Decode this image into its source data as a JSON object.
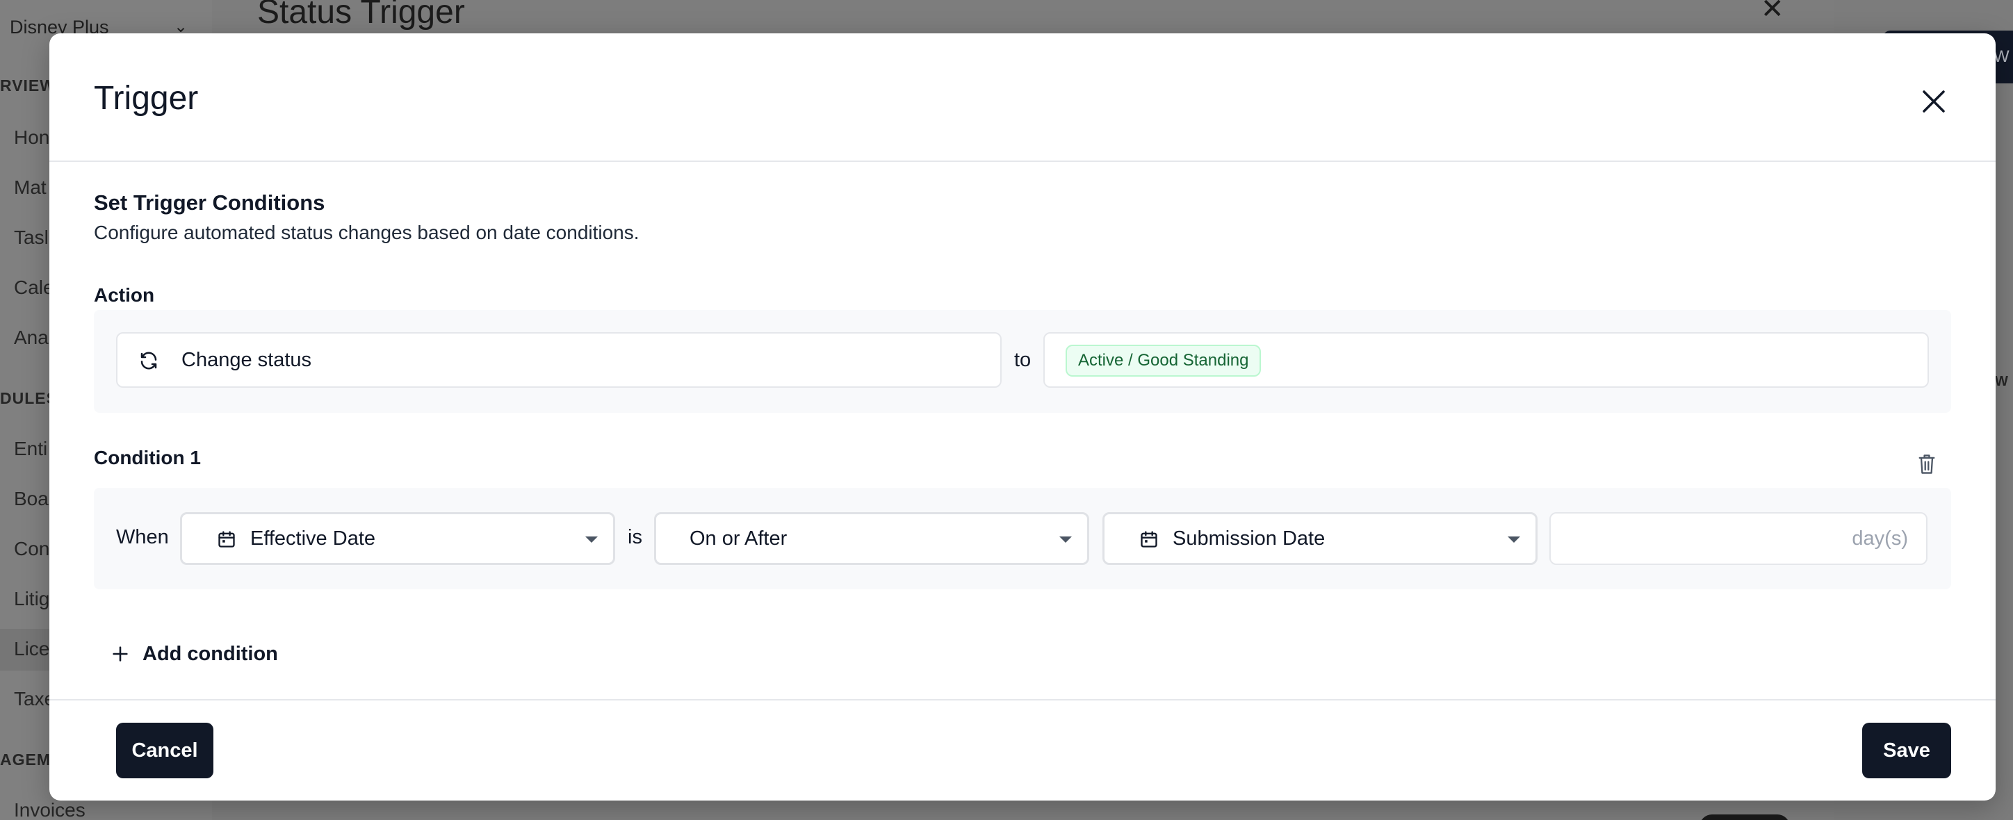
{
  "background": {
    "account": "Disney Plus",
    "sections": [
      "RVIEW",
      "DULES",
      "AGEM"
    ],
    "sidebar_items": [
      "Hon",
      "Mat",
      "Tasl",
      "Cale",
      "Ana",
      "Enti",
      "Boa",
      "Con",
      "Litig",
      "Lice",
      "Taxe",
      "Invoices"
    ],
    "dialog_title": "Status Trigger",
    "side_text": "W"
  },
  "modal": {
    "title": "Trigger",
    "section_title": "Set Trigger Conditions",
    "section_desc": "Configure automated status changes based on date conditions.",
    "action": {
      "label": "Action",
      "action_value": "Change status",
      "icon": "refresh-icon",
      "connector": "to",
      "status_badge": "Active / Good Standing",
      "badge_color": "#166534"
    },
    "condition": {
      "label": "Condition 1",
      "when_label": "When",
      "field_select": "Effective Date",
      "is_label": "is",
      "operator_select": "On or After",
      "compare_select": "Submission Date",
      "days_value": "",
      "days_placeholder": "day(s)"
    },
    "add_condition_label": "Add condition",
    "cancel_label": "Cancel",
    "save_label": "Save",
    "primary_color": "#111827"
  }
}
